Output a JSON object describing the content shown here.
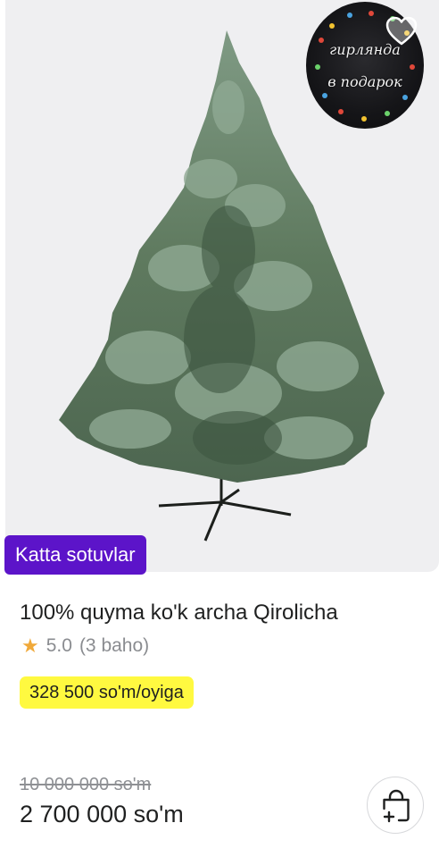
{
  "product": {
    "image_icon": "christmas-tree-image",
    "promo_line1": "гирлянда",
    "promo_line2": "в подарок",
    "badge": "Katta sotuvlar",
    "title": "100% quyma ko'k archa Qirolicha",
    "rating": "5.0",
    "reviews": "(3 baho)",
    "installment": "328 500 so'm/oyiga",
    "old_price": "10 000 000 so'm",
    "price": "2 700 000 so'm"
  },
  "icons": {
    "favorite": "heart-icon",
    "star": "star-icon",
    "cart": "add-to-cart-bag-icon"
  },
  "colors": {
    "badge": "#5c14c9",
    "installment_bg": "#fff940",
    "star": "#f0a93a"
  }
}
